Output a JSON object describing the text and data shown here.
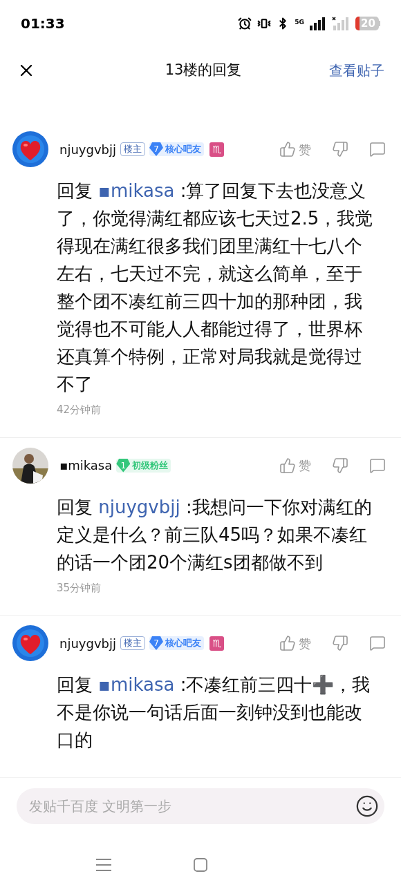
{
  "status_bar": {
    "time": "01:33",
    "network": "5G",
    "battery": "20"
  },
  "header": {
    "title": "13楼的回复",
    "link": "查看贴子"
  },
  "comments": [
    {
      "name": "njuygvbjj",
      "owner_badge": "楼主",
      "level": {
        "number": "7",
        "title": "核心吧友",
        "color": "#3b82f6"
      },
      "zodiac": "♏",
      "like_label": "赞",
      "reply_prefix": "回复",
      "reply_to": "▪mikasa",
      "text": ":算了回复下去也没意义了，你觉得满红都应该七天过2.5，我觉得现在满红很多我们团里满红十七八个左右，七天过不完，就这么简单，至于整个团不凑红前三四十加的那种团，我觉得也不可能人人都能过得了，世界杯还真算个特例，正常对局我就是觉得过不了",
      "time": "42分钟前"
    },
    {
      "name": "▪mikasa",
      "level": {
        "number": "1",
        "title": "初级粉丝",
        "color": "#34c77b"
      },
      "like_label": "赞",
      "reply_prefix": "回复",
      "reply_to": "njuygvbjj",
      "text": ":我想问一下你对满红的定义是什么？前三队45吗？如果不凑红的话一个团20个满红s团都做不到",
      "time": "35分钟前"
    },
    {
      "name": "njuygvbjj",
      "owner_badge": "楼主",
      "level": {
        "number": "7",
        "title": "核心吧友",
        "color": "#3b82f6"
      },
      "zodiac": "♏",
      "like_label": "赞",
      "reply_prefix": "回复",
      "reply_to": "▪mikasa",
      "text": ":不凑红前三四十➕，我不是你说一句话后面一刻钟没到也能改口的"
    }
  ],
  "input": {
    "placeholder": "发贴千百度 文明第一步"
  }
}
